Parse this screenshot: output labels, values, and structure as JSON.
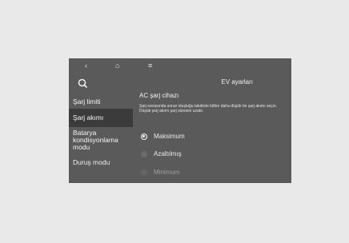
{
  "topbar": {
    "back_icon": "‹",
    "home_icon": "⌂",
    "menu_icon": "≡"
  },
  "sidebar": {
    "items": [
      {
        "label": "Şarj limiti"
      },
      {
        "label": "Şarj akımı",
        "active": true
      },
      {
        "label": "Batarya kondisyonlama modu"
      },
      {
        "label": "Duruş modu"
      }
    ]
  },
  "main": {
    "page_title": "EV ayarları",
    "section_title": "AC şarj cihazı",
    "description": "Şarj esnasında sorun oluştuğu takdirde lütfen daha düşük bir şarj akımı seçin. Düşük şarj akımı şarj süresini uzatır.",
    "options": [
      {
        "label": "Maksimum",
        "selected": true
      },
      {
        "label": "Azaltılmış",
        "selected": false
      },
      {
        "label": "Minimum",
        "selected": false
      }
    ]
  }
}
